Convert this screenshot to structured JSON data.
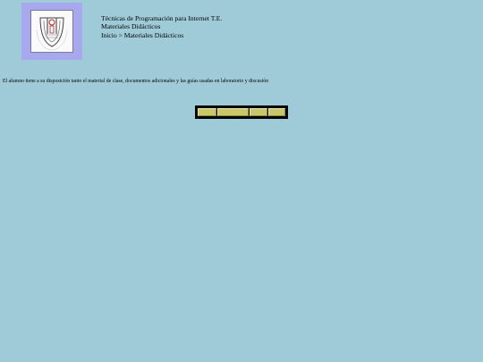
{
  "header": {
    "course_title": "Técnicas de Programación para Internet T.E.",
    "section_title": "Materiales Didácticos",
    "breadcrumb": "Inicio > Materiales Didácticos"
  },
  "intro_text": "El alumno tiene a su disposición tanto el material de clase, documentos adicionales y las guías usadas en laboratorio y discusión",
  "colors": {
    "page_background": "#9fcbd8",
    "logo_background": "#a8a8ee",
    "tab_fill": "#c9c66a"
  },
  "logo": {
    "icon": "university-seal-icon"
  }
}
